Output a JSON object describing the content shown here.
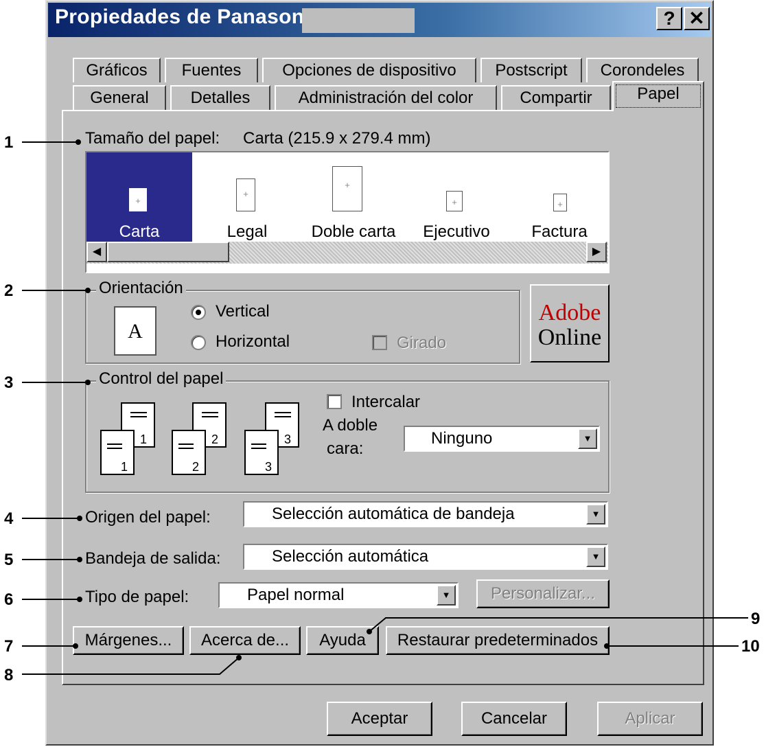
{
  "window": {
    "title": "Propiedades de Panasonic",
    "help_button": "?",
    "close_button": "✕"
  },
  "tabs": {
    "row1": [
      "Gráficos",
      "Fuentes",
      "Opciones de dispositivo",
      "Postscript",
      "Corondeles"
    ],
    "row2": [
      "General",
      "Detalles",
      "Administración del color",
      "Compartir",
      "Papel"
    ],
    "active": "Papel"
  },
  "paper_size": {
    "label": "Tamaño del papel:",
    "value": "Carta (215.9 x 279.4 mm)",
    "items": [
      "Carta",
      "Legal",
      "Doble carta",
      "Ejecutivo",
      "Factura"
    ],
    "selected": "Carta"
  },
  "orientation": {
    "group_label": "Orientación",
    "icon_letter": "A",
    "options": [
      "Vertical",
      "Horizontal"
    ],
    "selected": "Vertical",
    "rotated_label": "Girado"
  },
  "adobe": {
    "line1": "Adobe",
    "line2": "Online",
    "colors": {
      "line1": "#c00000",
      "line2": "#000000"
    }
  },
  "paper_control": {
    "group_label": "Control del papel",
    "collate_label": "Intercalar",
    "duplex_label_1": "A doble",
    "duplex_label_2": "cara:",
    "duplex_value": "Ninguno",
    "copies": [
      {
        "front": "1",
        "back": "1"
      },
      {
        "front": "2",
        "back": "2"
      },
      {
        "front": "3",
        "back": "3"
      }
    ]
  },
  "paper_source": {
    "label": "Origen del papel:",
    "value": "Selección automática de bandeja"
  },
  "output_tray": {
    "label": "Bandeja de salida:",
    "value": "Selección automática"
  },
  "paper_type": {
    "label": "Tipo de papel:",
    "value": "Papel normal",
    "customize": "Personalizar..."
  },
  "buttons": {
    "margins": "Márgenes...",
    "about": "Acerca de...",
    "help": "Ayuda",
    "restore": "Restaurar predeterminados",
    "ok": "Aceptar",
    "cancel": "Cancelar",
    "apply": "Aplicar"
  },
  "callouts": [
    "1",
    "2",
    "3",
    "4",
    "5",
    "6",
    "7",
    "8",
    "9",
    "10"
  ],
  "colors": {
    "title_start": "#0a246a",
    "face": "#c0c0c0",
    "selection": "#2a2a8c"
  }
}
